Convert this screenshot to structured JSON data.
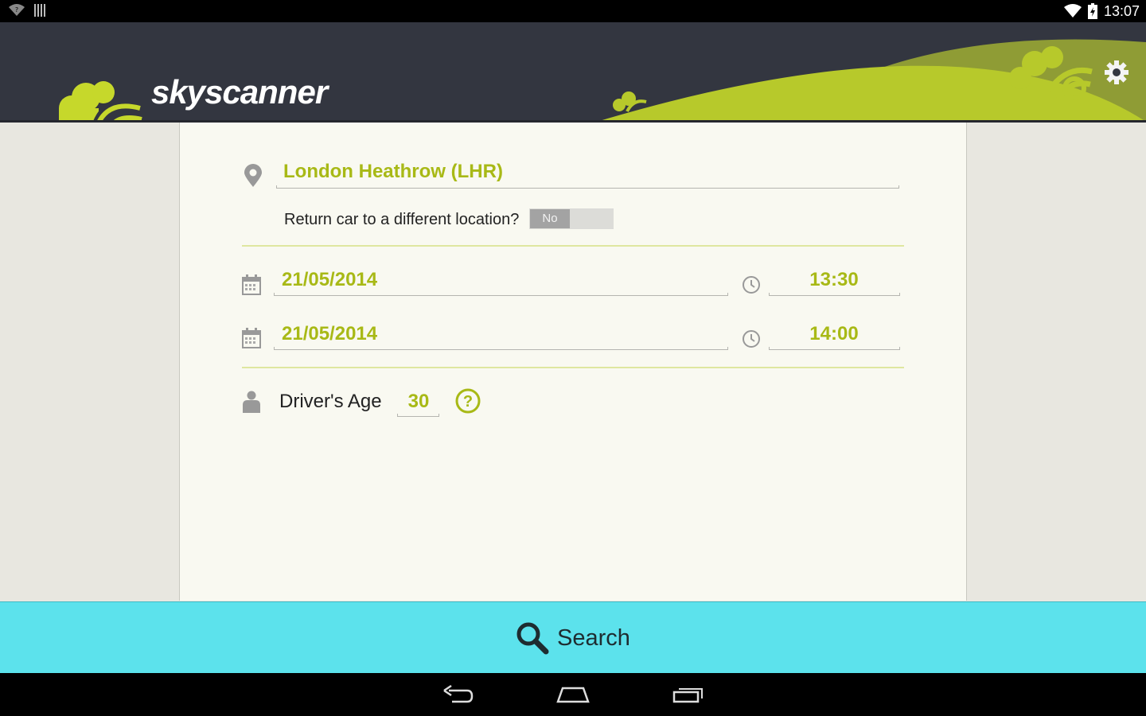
{
  "status": {
    "time": "13:07"
  },
  "brand": {
    "name": "skyscanner",
    "accent": "#a8b916",
    "header_bg": "#333640",
    "search_bg": "#5ce2ec"
  },
  "pickup": {
    "location": "London Heathrow (LHR)"
  },
  "return_location": {
    "label": "Return car to a different location?",
    "toggle_value": "No"
  },
  "pickup_datetime": {
    "date": "21/05/2014",
    "time": "13:30"
  },
  "dropoff_datetime": {
    "date": "21/05/2014",
    "time": "14:00"
  },
  "driver": {
    "label": "Driver's Age",
    "age": "30"
  },
  "search": {
    "label": "Search"
  },
  "icons": {
    "location": "map-pin-icon",
    "calendar": "calendar-icon",
    "clock": "clock-icon",
    "person": "person-icon",
    "help": "help-icon",
    "search": "search-icon",
    "settings": "gear-icon"
  }
}
